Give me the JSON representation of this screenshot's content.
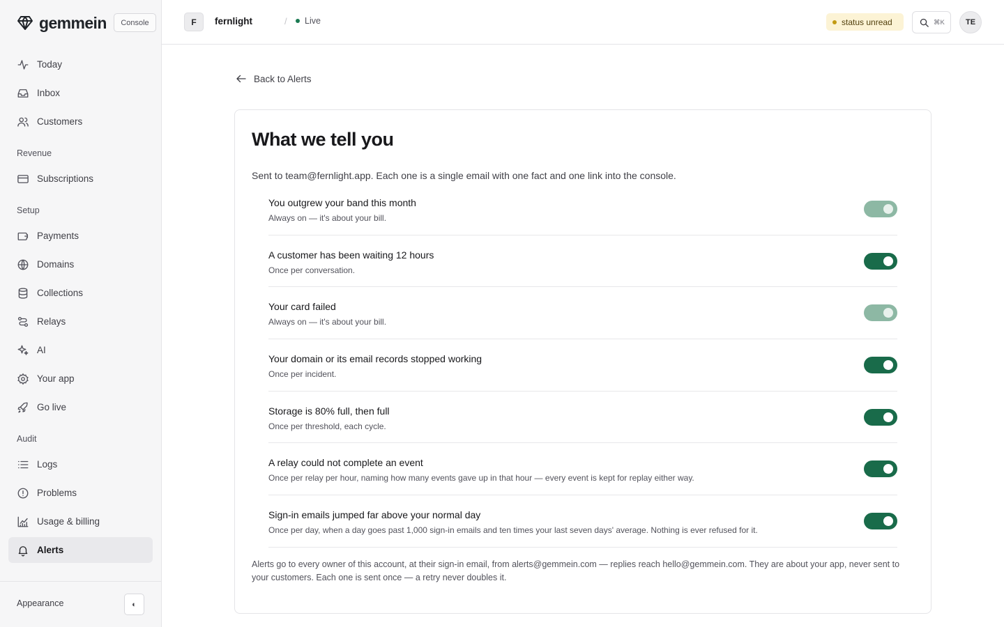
{
  "brand": {
    "name": "gemmein",
    "badge": "Console"
  },
  "sidebar": {
    "primary": [
      {
        "label": "Today",
        "icon": "activity-icon"
      },
      {
        "label": "Inbox",
        "icon": "inbox-icon"
      },
      {
        "label": "Customers",
        "icon": "users-icon"
      }
    ],
    "sections": [
      {
        "title": "Revenue",
        "items": [
          {
            "label": "Subscriptions",
            "icon": "credit-card-icon"
          }
        ]
      },
      {
        "title": "Setup",
        "items": [
          {
            "label": "Payments",
            "icon": "wallet-icon"
          },
          {
            "label": "Domains",
            "icon": "globe-icon"
          },
          {
            "label": "Collections",
            "icon": "database-icon"
          },
          {
            "label": "Relays",
            "icon": "route-icon"
          },
          {
            "label": "AI",
            "icon": "sparkles-icon"
          },
          {
            "label": "Your app",
            "icon": "gear-icon"
          },
          {
            "label": "Go live",
            "icon": "rocket-icon"
          }
        ]
      },
      {
        "title": "Audit",
        "items": [
          {
            "label": "Logs",
            "icon": "list-icon"
          },
          {
            "label": "Problems",
            "icon": "alert-circle-icon"
          },
          {
            "label": "Usage & billing",
            "icon": "chart-icon"
          },
          {
            "label": "Alerts",
            "icon": "bell-icon",
            "active": true
          }
        ]
      }
    ],
    "footer": {
      "appearance_label": "Appearance",
      "appearance_icon": "contrast-icon",
      "appearance_glyph": "◐"
    }
  },
  "topbar": {
    "project_initial": "F",
    "project_name": "fernlight",
    "separator": "/",
    "environment": "Live",
    "status": "status unread",
    "search_shortcut": "⌘K",
    "user_initials": "TE"
  },
  "main": {
    "back_label": "Back to Alerts",
    "title": "What we tell you",
    "description": "Sent to team@fernlight.app. Each one is a single email with one fact and one link into the console.",
    "alerts": [
      {
        "title": "You outgrew your band this month",
        "subtitle": "Always on — it's about your bill.",
        "on": true,
        "locked": true
      },
      {
        "title": "A customer has been waiting 12 hours",
        "subtitle": "Once per conversation.",
        "on": true,
        "locked": false
      },
      {
        "title": "Your card failed",
        "subtitle": "Always on — it's about your bill.",
        "on": true,
        "locked": true
      },
      {
        "title": "Your domain or its email records stopped working",
        "subtitle": "Once per incident.",
        "on": true,
        "locked": false
      },
      {
        "title": "Storage is 80% full, then full",
        "subtitle": "Once per threshold, each cycle.",
        "on": true,
        "locked": false
      },
      {
        "title": "A relay could not complete an event",
        "subtitle": "Once per relay per hour, naming how many events gave up in that hour — every event is kept for replay either way.",
        "on": true,
        "locked": false
      },
      {
        "title": "Sign-in emails jumped far above your normal day",
        "subtitle": "Once per day, when a day goes past 1,000 sign-in emails and ten times your last seven days' average. Nothing is ever refused for it.",
        "on": true,
        "locked": false
      }
    ],
    "footnote": "Alerts go to every owner of this account, at their sign-in email, from alerts@gemmein.com — replies reach hello@gemmein.com. They are about your app, never sent to your customers. Each one is sent once — a retry never doubles it."
  },
  "colors": {
    "accent": "#196b4a",
    "accent_locked": "#8db8a4",
    "live": "#1a7a52",
    "status_bg": "#fcf3d5",
    "status_dot": "#c29a12"
  }
}
